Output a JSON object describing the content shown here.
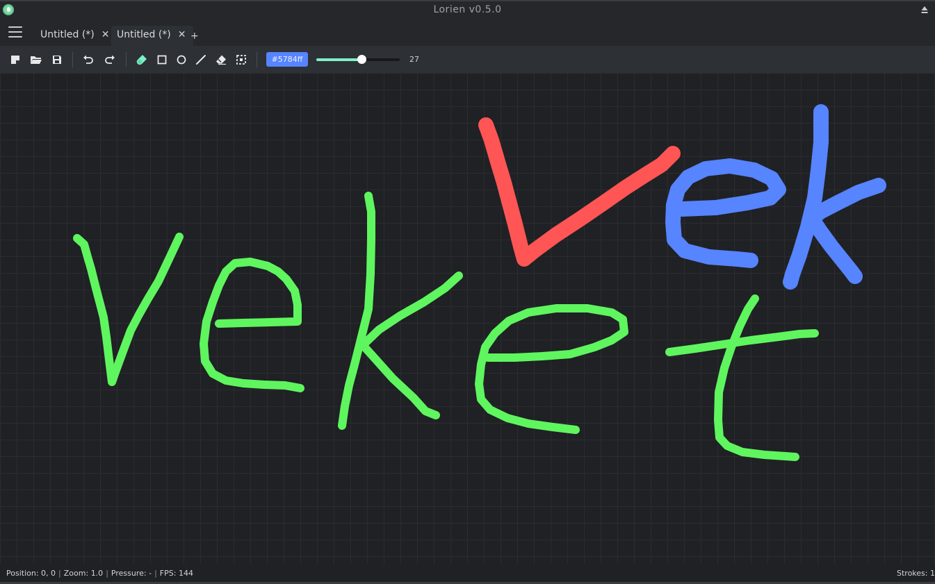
{
  "window": {
    "title": "Lorien v0.5.0"
  },
  "tabs": [
    {
      "label": "Untitled (*)",
      "active": false
    },
    {
      "label": "Untitled (*)",
      "active": true
    }
  ],
  "new_tab_label": "+",
  "toolbar": {
    "color_hex": "#5784ff",
    "color_label": "#5784ff",
    "brush_size": "27",
    "brush_size_fraction": 0.54,
    "tools": [
      "new-file-icon",
      "open-folder-icon",
      "save-icon",
      "undo-icon",
      "redo-icon",
      "brush-icon",
      "rectangle-icon",
      "circle-icon",
      "line-icon",
      "eraser-icon",
      "selection-icon"
    ],
    "active_tool": "brush-icon"
  },
  "status": {
    "position_label": "Position:",
    "position": "0, 0",
    "zoom_label": "Zoom:",
    "zoom": "1.0",
    "pressure_label": "Pressure:",
    "pressure": "-",
    "fps_label": "FPS:",
    "fps": "144",
    "strokes_label": "Strokes:",
    "strokes": "1"
  },
  "canvas": {
    "grid": true,
    "stroke_colors": {
      "green": "#5ff55f",
      "red": "#ff5555",
      "blue": "#5784ff"
    },
    "handwriting": [
      "veket",
      "Vek"
    ]
  }
}
